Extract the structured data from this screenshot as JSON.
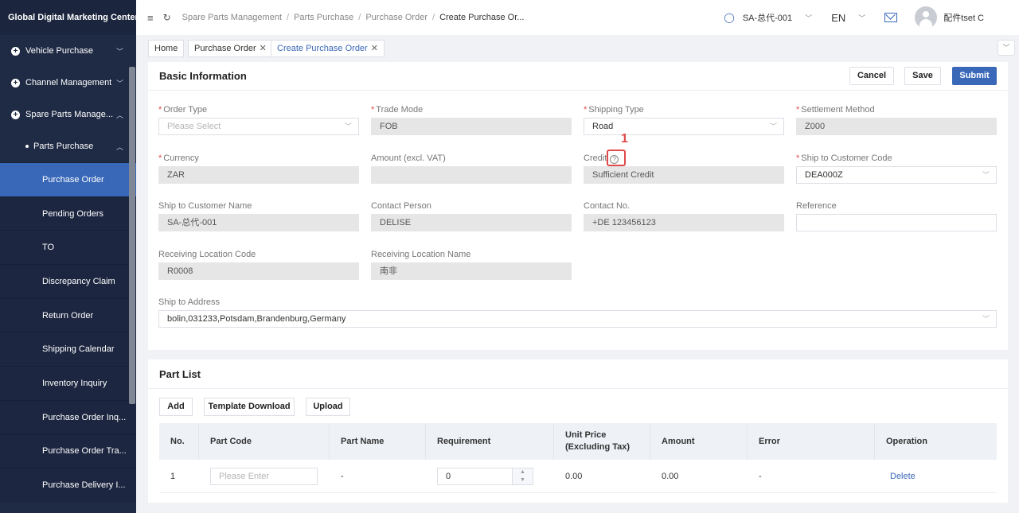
{
  "sidebar": {
    "brand": "Global Digital Marketing Center",
    "groups": [
      {
        "label": "Vehicle Purchase"
      },
      {
        "label": "Channel Management"
      },
      {
        "label": "Spare Parts Manage..."
      }
    ],
    "sub": {
      "label": "Parts Purchase"
    },
    "items": [
      {
        "label": "Purchase Order"
      },
      {
        "label": "Pending Orders"
      },
      {
        "label": "TO"
      },
      {
        "label": "Discrepancy Claim"
      },
      {
        "label": "Return Order"
      },
      {
        "label": "Shipping Calendar"
      },
      {
        "label": "Inventory Inquiry"
      },
      {
        "label": "Purchase Order Inq..."
      },
      {
        "label": "Purchase Order Tra..."
      },
      {
        "label": "Purchase Delivery I..."
      }
    ]
  },
  "topbar": {
    "crumbs": [
      "Spare Parts Management",
      "Parts Purchase",
      "Purchase Order",
      "Create Purchase Or..."
    ],
    "account": "SA-总代-001",
    "lang": "EN",
    "user": "配件tset C"
  },
  "tabs": [
    {
      "label": "Home"
    },
    {
      "label": "Purchase Order"
    },
    {
      "label": "Create Purchase Order"
    }
  ],
  "basic": {
    "title": "Basic Information",
    "cancel": "Cancel",
    "save": "Save",
    "submit": "Submit",
    "fields": {
      "order_type": {
        "label": "Order Type",
        "placeholder": "Please Select"
      },
      "trade_mode": {
        "label": "Trade Mode",
        "value": "FOB"
      },
      "shipping_type": {
        "label": "Shipping Type",
        "value": "Road"
      },
      "settlement": {
        "label": "Settlement Method",
        "value": "Z000"
      },
      "currency": {
        "label": "Currency",
        "value": "ZAR"
      },
      "amount": {
        "label": "Amount (excl. VAT)",
        "value": ""
      },
      "credit": {
        "label": "Credit",
        "value": "Sufficient Credit"
      },
      "ship_code": {
        "label": "Ship to Customer Code",
        "value": "DEA000Z"
      },
      "ship_name": {
        "label": "Ship to Customer Name",
        "value": "SA-总代-001"
      },
      "contact_person": {
        "label": "Contact Person",
        "value": "DELISE"
      },
      "contact_no": {
        "label": "Contact No.",
        "value": "+DE 123456123"
      },
      "reference": {
        "label": "Reference",
        "value": ""
      },
      "recv_code": {
        "label": "Receiving Location Code",
        "value": "R0008"
      },
      "recv_name": {
        "label": "Receiving Location Name",
        "value": "南非"
      },
      "address": {
        "label": "Ship to Address",
        "value": "bolin,031233,Potsdam,Brandenburg,Germany"
      }
    }
  },
  "annotation": {
    "number": "1"
  },
  "parts": {
    "title": "Part List",
    "add": "Add",
    "template": "Template Download",
    "upload": "Upload",
    "columns": [
      "No.",
      "Part Code",
      "Part Name",
      "Requirement",
      "Unit Price (Excluding Tax)",
      "Amount",
      "Error",
      "Operation"
    ],
    "rows": [
      {
        "no": "1",
        "part_code_placeholder": "Please Enter",
        "part_name": "-",
        "requirement": "0",
        "unit_price": "0.00",
        "amount": "0.00",
        "error": "-",
        "operation": "Delete"
      }
    ]
  },
  "colors": {
    "accent": "#3a68b8",
    "sidebar": "#1f2a44",
    "required": "#e04a4a"
  }
}
